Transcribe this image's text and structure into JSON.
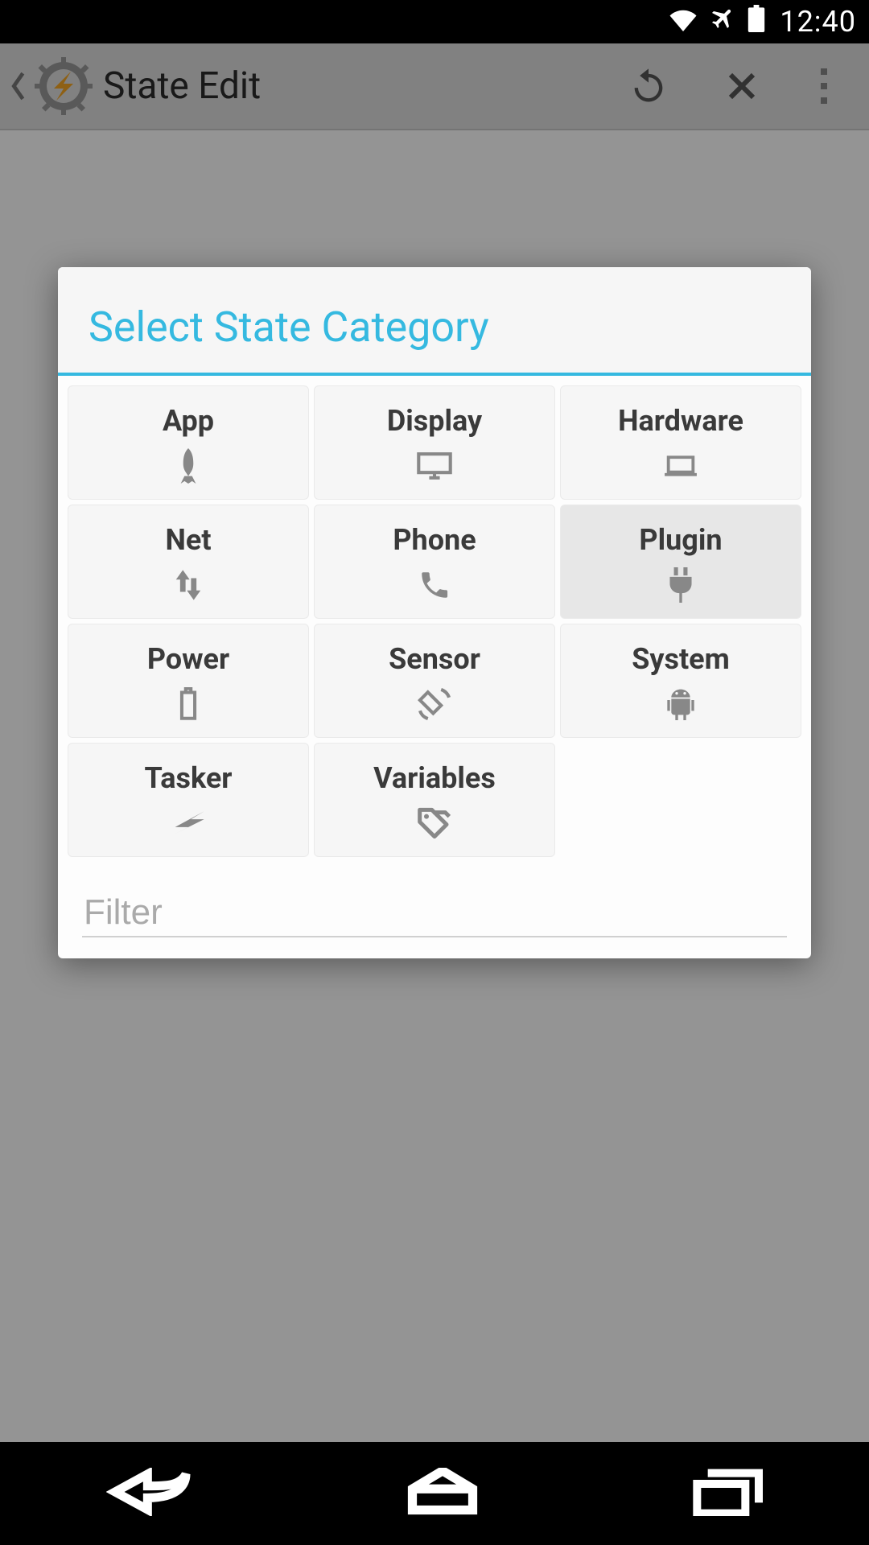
{
  "status": {
    "time": "12:40"
  },
  "actionbar": {
    "title": "State Edit"
  },
  "modal": {
    "title": "Select State Category",
    "categories": [
      {
        "label": "App",
        "icon": "rocket",
        "selected": false
      },
      {
        "label": "Display",
        "icon": "monitor",
        "selected": false
      },
      {
        "label": "Hardware",
        "icon": "laptop",
        "selected": false
      },
      {
        "label": "Net",
        "icon": "updown",
        "selected": false
      },
      {
        "label": "Phone",
        "icon": "phone",
        "selected": false
      },
      {
        "label": "Plugin",
        "icon": "plug",
        "selected": true
      },
      {
        "label": "Power",
        "icon": "battery",
        "selected": false
      },
      {
        "label": "Sensor",
        "icon": "rotate",
        "selected": false
      },
      {
        "label": "System",
        "icon": "android",
        "selected": false
      },
      {
        "label": "Tasker",
        "icon": "bolt",
        "selected": false
      },
      {
        "label": "Variables",
        "icon": "tags",
        "selected": false
      }
    ],
    "filter_placeholder": "Filter"
  }
}
